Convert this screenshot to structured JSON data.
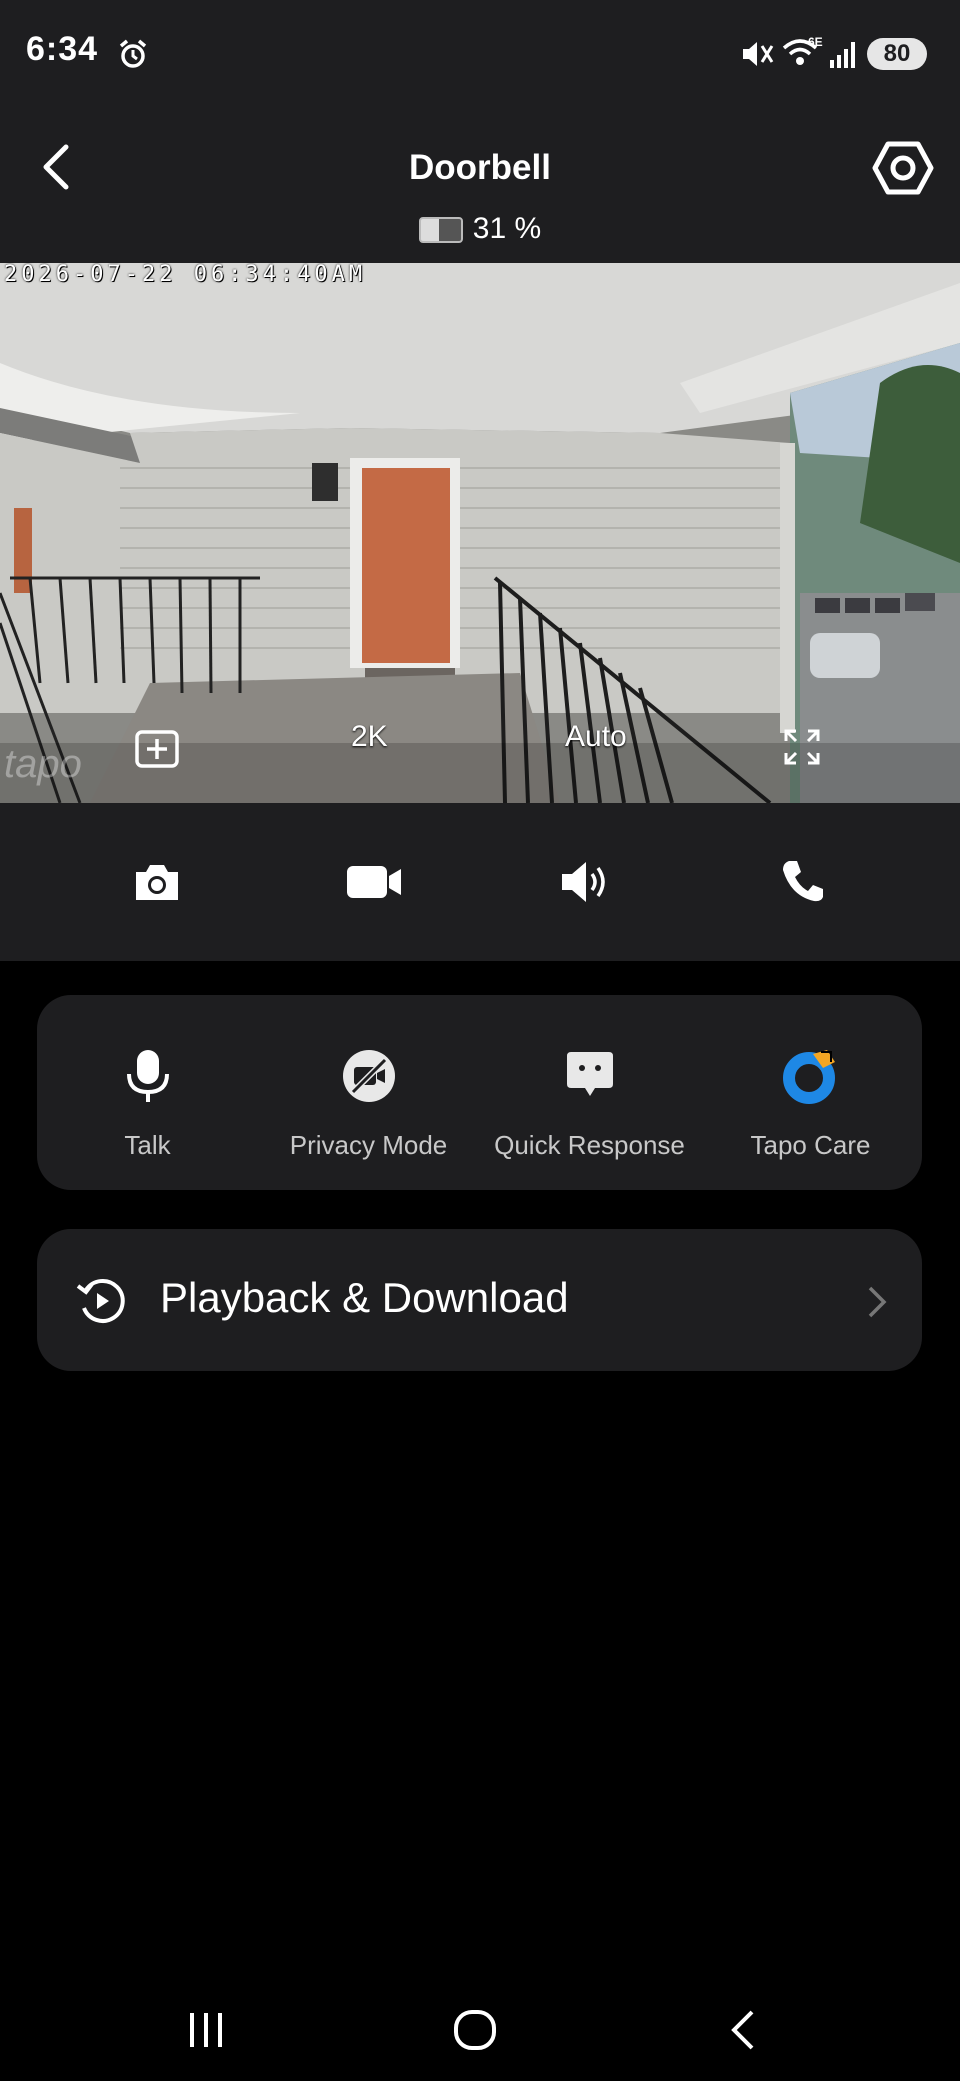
{
  "status_bar": {
    "time": "6:34",
    "battery": "80",
    "network": "6E"
  },
  "header": {
    "title": "Doorbell",
    "battery_text": "31 %",
    "battery_level": 0.31
  },
  "video": {
    "timestamp": "2026-07-22 06:34:40AM",
    "watermark": "tapo",
    "resolution": "2K",
    "mode": "Auto"
  },
  "toolbar": {
    "icons": [
      "camera-icon",
      "video-record-icon",
      "speaker-icon",
      "phone-icon"
    ]
  },
  "quick_actions": [
    {
      "label": "Talk",
      "icon": "microphone-icon"
    },
    {
      "label": "Privacy Mode",
      "icon": "privacy-mode-icon"
    },
    {
      "label": "Quick Response",
      "icon": "quick-response-icon"
    },
    {
      "label": "Tapo Care",
      "icon": "tapo-care-icon"
    }
  ],
  "playback": {
    "label": "Playback & Download"
  },
  "colors": {
    "panel": "#1e1e20",
    "background": "#000000",
    "tapo_care_blue": "#1e88e5",
    "tapo_care_accent": "#f5a623"
  }
}
